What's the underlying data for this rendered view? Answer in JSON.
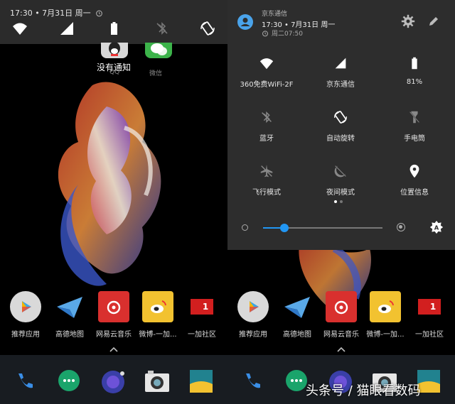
{
  "status": {
    "time_date": "17:30 • 7月31日 周一"
  },
  "home": {
    "no_notifications": "没有通知",
    "qq_label": "QQ",
    "wechat_label": "微信",
    "apps": [
      {
        "label": "推荐应用"
      },
      {
        "label": "高德地图"
      },
      {
        "label": "网易云音乐"
      },
      {
        "label": "微博-一加..."
      },
      {
        "label": "一加社区"
      }
    ],
    "community_badge": "1"
  },
  "quick_settings": {
    "carrier": "京东通信",
    "time_date": "17:30 • 7月31日 周一",
    "alarm": "周二07:50",
    "tiles": [
      {
        "label": "360免费WiFi-2F",
        "icon": "wifi-icon"
      },
      {
        "label": "京东通信",
        "icon": "signal-icon"
      },
      {
        "label": "81%",
        "icon": "battery-icon"
      },
      {
        "label": "蓝牙",
        "icon": "bluetooth-off-icon"
      },
      {
        "label": "自动旋转",
        "icon": "auto-rotate-icon"
      },
      {
        "label": "手电筒",
        "icon": "flashlight-off-icon"
      },
      {
        "label": "飞行模式",
        "icon": "airplane-off-icon"
      },
      {
        "label": "夜间模式",
        "icon": "night-mode-off-icon"
      },
      {
        "label": "位置信息",
        "icon": "location-icon"
      }
    ],
    "brightness": 0.18,
    "accent": "#2196f3"
  },
  "watermark": "头条号 / 猫眼看数码"
}
